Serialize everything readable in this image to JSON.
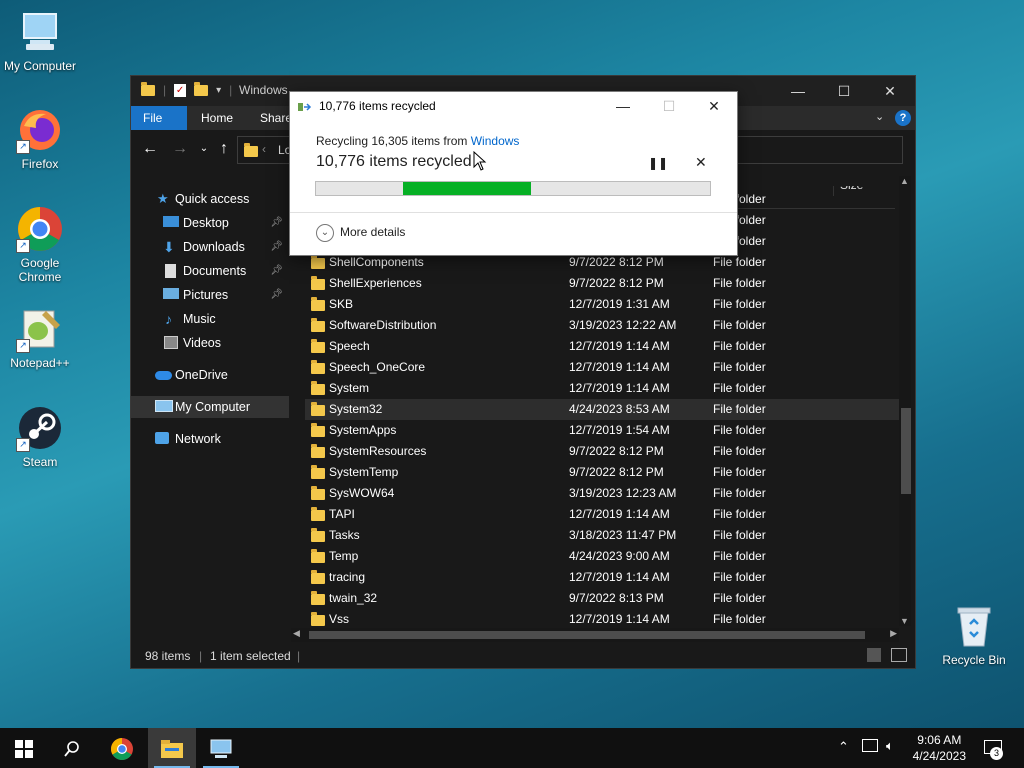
{
  "desktop": {
    "icons": [
      {
        "label": "My Computer"
      },
      {
        "label": "Firefox"
      },
      {
        "label": "Google Chrome"
      },
      {
        "label": "Notepad++"
      },
      {
        "label": "Steam"
      },
      {
        "label": "Recycle Bin"
      }
    ]
  },
  "explorer": {
    "title": "Windows",
    "ribbon_tabs": [
      "File",
      "Home",
      "Share"
    ],
    "address_partial": "Lo",
    "size_header": "Size",
    "sidebar": [
      {
        "label": "Quick access",
        "icon": "star-icon"
      },
      {
        "label": "Desktop",
        "icon": "desktop-icon",
        "pinned": true
      },
      {
        "label": "Downloads",
        "icon": "download-icon",
        "pinned": true
      },
      {
        "label": "Documents",
        "icon": "document-icon",
        "pinned": true
      },
      {
        "label": "Pictures",
        "icon": "picture-icon",
        "pinned": true
      },
      {
        "label": "Music",
        "icon": "music-icon"
      },
      {
        "label": "Videos",
        "icon": "video-icon"
      },
      {
        "label": "OneDrive",
        "icon": "cloud-icon"
      },
      {
        "label": "My Computer",
        "icon": "computer-icon",
        "selected": true
      },
      {
        "label": "Network",
        "icon": "network-icon"
      }
    ],
    "partial_rows_type": [
      "File folder",
      "File folder",
      "File folder"
    ],
    "rows": [
      {
        "name": "ShellComponents",
        "date": "9/7/2022 8:12 PM",
        "type": "File folder"
      },
      {
        "name": "ShellExperiences",
        "date": "9/7/2022 8:12 PM",
        "type": "File folder"
      },
      {
        "name": "SKB",
        "date": "12/7/2019 1:31 AM",
        "type": "File folder"
      },
      {
        "name": "SoftwareDistribution",
        "date": "3/19/2023 12:22 AM",
        "type": "File folder"
      },
      {
        "name": "Speech",
        "date": "12/7/2019 1:14 AM",
        "type": "File folder"
      },
      {
        "name": "Speech_OneCore",
        "date": "12/7/2019 1:14 AM",
        "type": "File folder"
      },
      {
        "name": "System",
        "date": "12/7/2019 1:14 AM",
        "type": "File folder"
      },
      {
        "name": "System32",
        "date": "4/24/2023 8:53 AM",
        "type": "File folder",
        "selected": true
      },
      {
        "name": "SystemApps",
        "date": "12/7/2019 1:54 AM",
        "type": "File folder"
      },
      {
        "name": "SystemResources",
        "date": "9/7/2022 8:12 PM",
        "type": "File folder"
      },
      {
        "name": "SystemTemp",
        "date": "9/7/2022 8:12 PM",
        "type": "File folder"
      },
      {
        "name": "SysWOW64",
        "date": "3/19/2023 12:23 AM",
        "type": "File folder"
      },
      {
        "name": "TAPI",
        "date": "12/7/2019 1:14 AM",
        "type": "File folder"
      },
      {
        "name": "Tasks",
        "date": "3/18/2023 11:47 PM",
        "type": "File folder"
      },
      {
        "name": "Temp",
        "date": "4/24/2023 9:00 AM",
        "type": "File folder"
      },
      {
        "name": "tracing",
        "date": "12/7/2019 1:14 AM",
        "type": "File folder"
      },
      {
        "name": "twain_32",
        "date": "9/7/2022 8:13 PM",
        "type": "File folder"
      },
      {
        "name": "Vss",
        "date": "12/7/2019 1:14 AM",
        "type": "File folder"
      }
    ],
    "status": {
      "count": "98 items",
      "selection": "1 item selected"
    }
  },
  "dialog": {
    "title": "10,776 items recycled",
    "line1_prefix": "Recycling 16,305 items from ",
    "line1_link": "Windows",
    "line2": "10,776 items recycled",
    "progress_start": 0.22,
    "progress_end": 0.546,
    "more_details": "More details",
    "pause_icon": "pause-icon",
    "cancel_icon": "close-icon"
  },
  "taskbar": {
    "time": "9:06 AM",
    "date": "4/24/2023",
    "notification_count": "3"
  },
  "colors": {
    "accent": "#1a73c8",
    "progress": "#06b025",
    "link": "#0066cc"
  }
}
